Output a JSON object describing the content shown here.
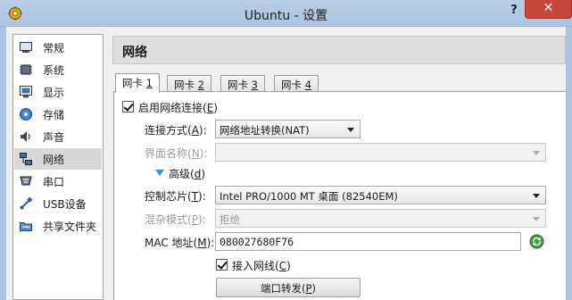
{
  "window": {
    "title": "Ubuntu - 设置",
    "help_label": "?",
    "close_label": "✕"
  },
  "sidebar": {
    "items": [
      {
        "label": "常规",
        "icon": "general-icon"
      },
      {
        "label": "系统",
        "icon": "system-chip-icon"
      },
      {
        "label": "显示",
        "icon": "display-monitor-icon"
      },
      {
        "label": "存储",
        "icon": "storage-disc-icon"
      },
      {
        "label": "声音",
        "icon": "sound-speaker-icon"
      },
      {
        "label": "网络",
        "icon": "network-icon",
        "selected": true
      },
      {
        "label": "串口",
        "icon": "serial-port-icon"
      },
      {
        "label": "USB设备",
        "icon": "usb-icon"
      },
      {
        "label": "共享文件夹",
        "icon": "shared-folder-icon"
      }
    ]
  },
  "header": {
    "title": "网络"
  },
  "tabs": [
    {
      "label": "网卡 ",
      "key": "1",
      "active": true
    },
    {
      "label": "网卡 ",
      "key": "2"
    },
    {
      "label": "网卡 ",
      "key": "3"
    },
    {
      "label": "网卡 ",
      "key": "4"
    }
  ],
  "adapter": {
    "enable": {
      "label": "启用网络连接(",
      "key": "E",
      "suffix": ")",
      "checked": true
    },
    "attached_to": {
      "label": "连接方式(",
      "key": "A",
      "suffix": "):",
      "value": "网络地址转换(NAT)"
    },
    "name": {
      "label": "界面名称(",
      "key": "N",
      "suffix": "):",
      "value": ""
    },
    "advanced": {
      "label": "高级(",
      "key": "d",
      "suffix": ")"
    },
    "adapter_type": {
      "label": "控制芯片(",
      "key": "T",
      "suffix": "):",
      "value": "Intel PRO/1000 MT 桌面 (82540EM)"
    },
    "promiscuous": {
      "label": "混杂模式(",
      "key": "P",
      "suffix": "):",
      "value": "拒绝"
    },
    "mac": {
      "label": "MAC 地址(",
      "key": "M",
      "suffix": "):",
      "value": "080027680F76"
    },
    "cable": {
      "label": "接入网线(",
      "key": "C",
      "suffix": ")",
      "checked": true
    },
    "port_forwarding": {
      "label": "端口转发(",
      "key": "P",
      "suffix": ")"
    }
  },
  "colors": {
    "titlebar": "#b7cfe6",
    "close_button": "#c7453a",
    "selected_item": "#d9d9d9",
    "expander_arrow": "#3d8fd6",
    "refresh_icon": "#3aa33a"
  }
}
